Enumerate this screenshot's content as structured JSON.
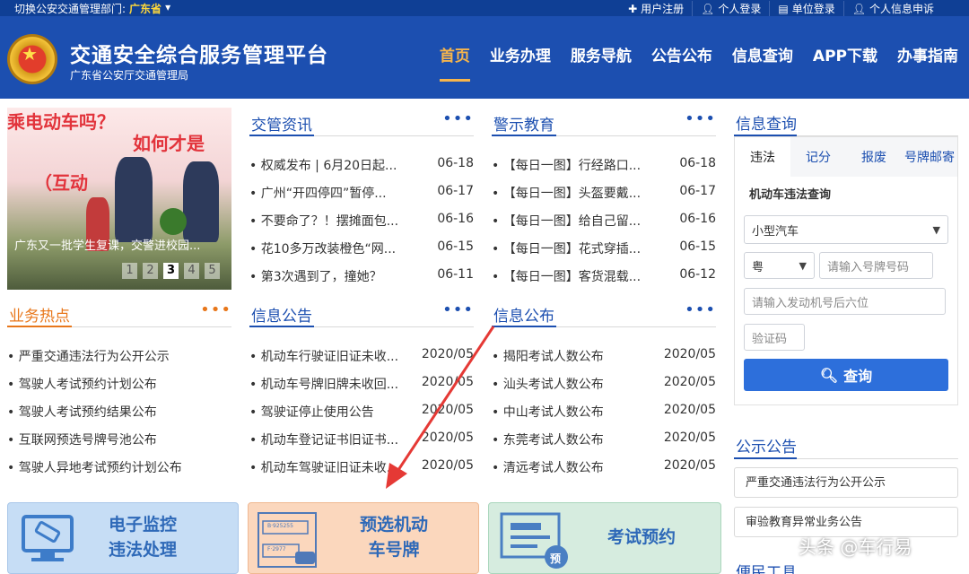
{
  "topbar": {
    "dept_label": "切换公安交通管理部门:",
    "dept_value": "广东省",
    "links": [
      {
        "icon": "plus-icon",
        "label": "用户注册"
      },
      {
        "icon": "user-icon",
        "label": "个人登录"
      },
      {
        "icon": "building-icon",
        "label": "单位登录"
      },
      {
        "icon": "user-icon",
        "label": "个人信息申诉"
      }
    ]
  },
  "header": {
    "title": "交通安全综合服务管理平台",
    "subtitle": "广东省公安厅交通管理局",
    "nav": [
      "首页",
      "业务办理",
      "服务导航",
      "公告公布",
      "信息查询",
      "APP下载",
      "办事指南"
    ]
  },
  "banner": {
    "text1": "乘电动车吗？",
    "text2": "如何才是",
    "text3": "（互动",
    "caption": "广东又一批学生复课，交警进校园...",
    "pages": [
      "1",
      "2",
      "3",
      "4",
      "5"
    ],
    "current_page": "3"
  },
  "panels": {
    "traffic_news": {
      "title": "交管资讯",
      "more": "•••",
      "items": [
        {
          "text": "• 权威发布 | 6月20日起...",
          "date": "06-18"
        },
        {
          "text": "• 广州“开四停四”暂停...",
          "date": "06-17"
        },
        {
          "text": "• 不要命了？！摆摊面包...",
          "date": "06-16"
        },
        {
          "text": "• 花10多万改装橙色“网...",
          "date": "06-15"
        },
        {
          "text": "• 第3次遇到了，撞她？",
          "date": "06-11"
        }
      ]
    },
    "warning_edu": {
      "title": "警示教育",
      "more": "•••",
      "items": [
        {
          "text": "• 【每日一图】行经路口...",
          "date": "06-18"
        },
        {
          "text": "• 【每日一图】头盔要戴...",
          "date": "06-17"
        },
        {
          "text": "• 【每日一图】给自己留...",
          "date": "06-16"
        },
        {
          "text": "• 【每日一图】花式穿插...",
          "date": "06-15"
        },
        {
          "text": "• 【每日一图】客货混载...",
          "date": "06-12"
        }
      ]
    },
    "hot_business": {
      "title": "业务热点",
      "more": "•••",
      "items": [
        "• 严重交通违法行为公开公示",
        "• 驾驶人考试预约计划公布",
        "• 驾驶人考试预约结果公布",
        "• 互联网预选号牌号池公布",
        "• 驾驶人异地考试预约计划公布"
      ]
    },
    "info_notice": {
      "title": "信息公告",
      "more": "•••",
      "items": [
        {
          "text": "• 机动车行驶证旧证未收...",
          "date": "2020/05"
        },
        {
          "text": "• 机动车号牌旧牌未收回...",
          "date": "2020/05"
        },
        {
          "text": "• 驾驶证停止使用公告",
          "date": "2020/05"
        },
        {
          "text": "• 机动车登记证书旧证书...",
          "date": "2020/05"
        },
        {
          "text": "• 机动车驾驶证旧证未收...",
          "date": "2020/05"
        }
      ]
    },
    "info_publish": {
      "title": "信息公布",
      "more": "•••",
      "items": [
        {
          "text": "• 揭阳考试人数公布",
          "date": "2020/05"
        },
        {
          "text": "• 汕头考试人数公布",
          "date": "2020/05"
        },
        {
          "text": "• 中山考试人数公布",
          "date": "2020/05"
        },
        {
          "text": "• 东莞考试人数公布",
          "date": "2020/05"
        },
        {
          "text": "• 清远考试人数公布",
          "date": "2020/05"
        }
      ]
    }
  },
  "info_query": {
    "title": "信息查询",
    "tabs": [
      "违法",
      "记分",
      "报废",
      "号牌邮寄"
    ],
    "active_tab": "违法",
    "form_title": "机动车违法查询",
    "vehicle_type": "小型汽车",
    "province": "粤",
    "plate_placeholder": "请输入号牌号码",
    "engine_placeholder": "请输入发动机号后六位",
    "captcha_placeholder": "验证码",
    "submit": "查询"
  },
  "public_notice": {
    "title": "公示公告",
    "items": [
      "严重交通违法行为公开公示",
      "审验教育异常业务公告"
    ]
  },
  "convenience_title": "便民工具",
  "cards": [
    {
      "line1": "电子监控",
      "line2": "违法处理"
    },
    {
      "line1": "预选机动",
      "line2": "车号牌"
    },
    {
      "line1": "考试预约",
      "line2": ""
    }
  ],
  "card_plate_samples": [
    "B·925255",
    "F·2977"
  ],
  "card_badge": "预",
  "watermark": "头条 @车行易",
  "colors": {
    "brand": "#1c4fb0",
    "topbar": "#0f3f95",
    "active_nav": "#f6b54c",
    "accent_orange": "#e8771b",
    "query_button": "#2d6fdb"
  }
}
